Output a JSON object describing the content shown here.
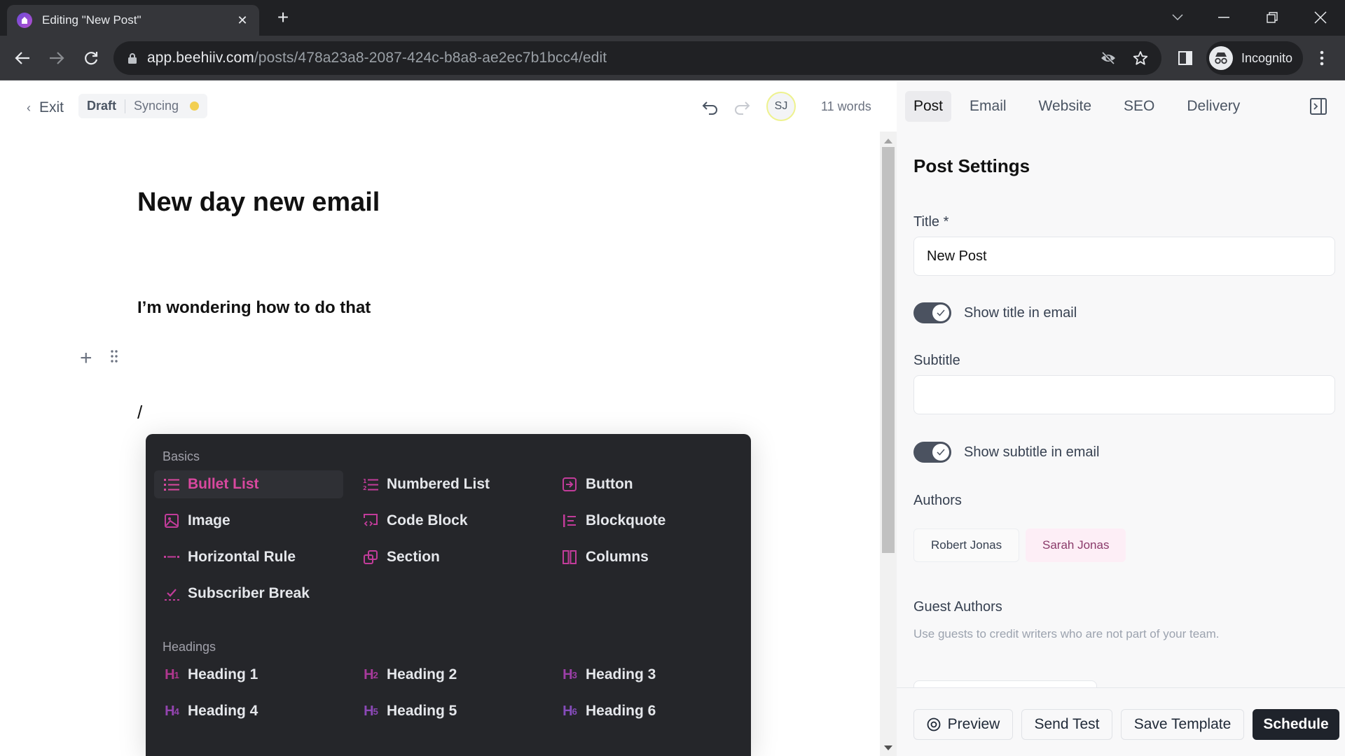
{
  "browser": {
    "tab_title": "Editing \"New Post\"",
    "url_host": "app.beehiiv.com",
    "url_path": "/posts/478a23a8-2087-424c-b8a8-ae2ec7b1bcc4/edit",
    "profile_label": "Incognito"
  },
  "topbar": {
    "exit_label": "Exit",
    "status_draft": "Draft",
    "status_sync": "Syncing",
    "sync_color": "#f2cf52",
    "avatar_initials": "SJ",
    "word_count": "11 words"
  },
  "document": {
    "title": "New day new email",
    "subtitle_line": "I’m wondering how to do that",
    "slash_text": "/"
  },
  "slash_menu": {
    "sections": [
      {
        "label": "Basics",
        "items": [
          {
            "label": "Bullet List",
            "icon": "bullet-list-icon",
            "active": true
          },
          {
            "label": "Numbered List",
            "icon": "numbered-list-icon"
          },
          {
            "label": "Button",
            "icon": "button-icon"
          },
          {
            "label": "Image",
            "icon": "image-icon"
          },
          {
            "label": "Code Block",
            "icon": "code-block-icon"
          },
          {
            "label": "Blockquote",
            "icon": "blockquote-icon"
          },
          {
            "label": "Horizontal Rule",
            "icon": "horizontal-rule-icon"
          },
          {
            "label": "Section",
            "icon": "section-icon"
          },
          {
            "label": "Columns",
            "icon": "columns-icon"
          },
          {
            "label": "Subscriber Break",
            "icon": "subscriber-break-icon"
          }
        ]
      },
      {
        "label": "Headings",
        "items": [
          {
            "label": "Heading 1",
            "icon": "heading-1-icon",
            "glyph": "H",
            "level": "1"
          },
          {
            "label": "Heading 2",
            "icon": "heading-2-icon",
            "glyph": "H",
            "level": "2"
          },
          {
            "label": "Heading 3",
            "icon": "heading-3-icon",
            "glyph": "H",
            "level": "3"
          },
          {
            "label": "Heading 4",
            "icon": "heading-4-icon",
            "glyph": "H",
            "level": "4"
          },
          {
            "label": "Heading 5",
            "icon": "heading-5-icon",
            "glyph": "H",
            "level": "5"
          },
          {
            "label": "Heading 6",
            "icon": "heading-6-icon",
            "glyph": "H",
            "level": "6"
          }
        ]
      }
    ],
    "accent_color": "#d9489f"
  },
  "sidebar": {
    "tabs": [
      {
        "label": "Post",
        "active": true
      },
      {
        "label": "Email"
      },
      {
        "label": "Website"
      },
      {
        "label": "SEO"
      },
      {
        "label": "Delivery"
      }
    ],
    "heading": "Post Settings",
    "title_label": "Title *",
    "title_value": "New Post",
    "show_title_label": "Show title in email",
    "show_title_on": true,
    "subtitle_label": "Subtitle",
    "subtitle_value": "",
    "show_subtitle_label": "Show subtitle in email",
    "show_subtitle_on": true,
    "authors_label": "Authors",
    "authors": [
      {
        "name": "Robert Jonas",
        "selected": false
      },
      {
        "name": "Sarah Jonas",
        "selected": true
      }
    ],
    "guest_authors_label": "Guest Authors",
    "guest_authors_hint": "Use guests to credit writers who are not part of your team."
  },
  "footer": {
    "preview_label": "Preview",
    "send_test_label": "Send Test",
    "save_template_label": "Save Template",
    "schedule_label": "Schedule"
  }
}
